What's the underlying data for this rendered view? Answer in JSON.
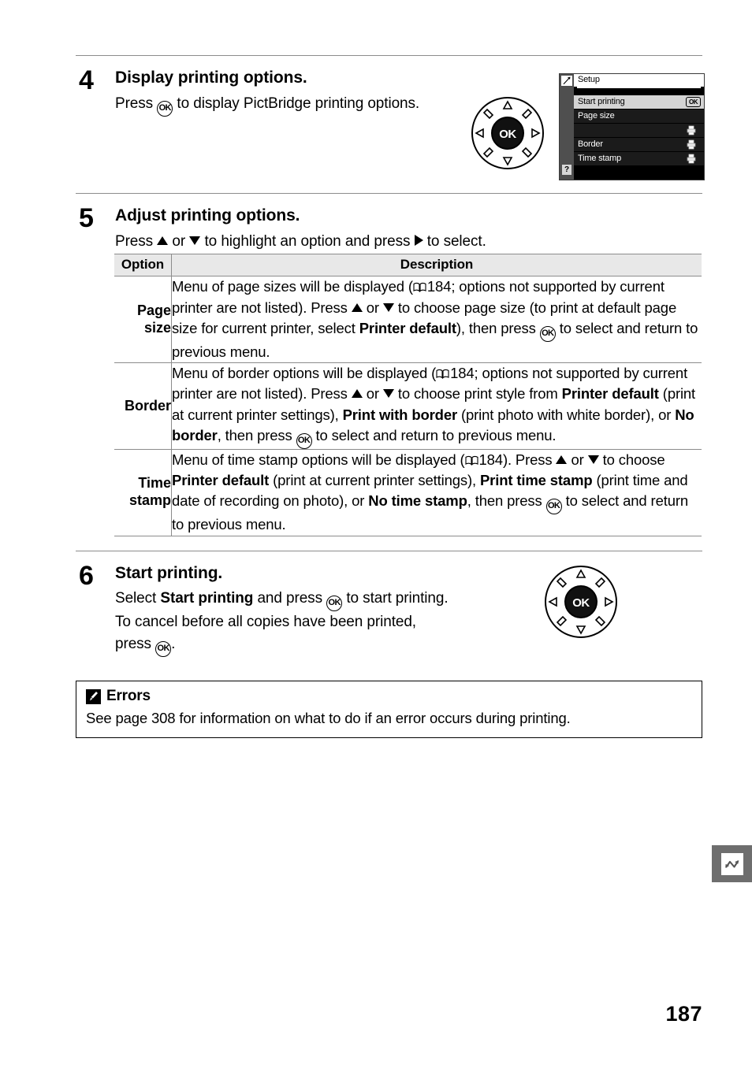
{
  "page": {
    "number": "187"
  },
  "steps": [
    {
      "number": "4",
      "title": "Display printing options.",
      "text_before_ok": "Press ",
      "text_after_ok": " to display PictBridge printing options."
    },
    {
      "number": "5",
      "title": "Adjust printing options.",
      "instruction_1": "Press ",
      "instruction_2": " or ",
      "instruction_3": " to highlight an option and press ",
      "instruction_4": " to select."
    },
    {
      "number": "6",
      "title": "Start printing.",
      "t1": "Select ",
      "t2": "Start printing",
      "t3": " and press ",
      "t4": " to start printing.  To cancel before all copies have been printed, press ",
      "t5": "."
    }
  ],
  "table": {
    "headers": {
      "option": "Option",
      "description": "Description"
    },
    "rows": [
      {
        "option_line1": "Page",
        "option_line2": "size",
        "description": {
          "s1": "Menu of page sizes will be displayed (",
          "page_ref": "184",
          "s2": "; options not supported by current printer are not listed).  Press ",
          "s3": " or ",
          "s4": " to choose page size (to print at default page size for current printer, select ",
          "bold1": "Printer default",
          "s5": "), then press ",
          "s6": " to select and return to previous menu."
        }
      },
      {
        "option_line1": "Border",
        "option_line2": "",
        "description": {
          "s1": "Menu of border options will be displayed (",
          "page_ref": "184",
          "s2": "; options not supported by current printer are not listed).  Press ",
          "s3": " or ",
          "s4": " to choose print style from ",
          "bold1": "Printer default",
          "s5": " (print at current printer settings), ",
          "bold2": "Print with border",
          "s6": " (print photo with white border), or ",
          "bold3": "No border",
          "s7": ", then press ",
          "s8": " to select and return to previous menu."
        }
      },
      {
        "option_line1": "Time",
        "option_line2": "stamp",
        "description": {
          "s1": "Menu of time stamp options will be displayed (",
          "page_ref": "184",
          "s2": ").  Press ",
          "s3": " or ",
          "s4": " to choose ",
          "bold1": "Printer default",
          "s5": " (print at current printer settings), ",
          "bold2": "Print time stamp",
          "s6": " (print time and date of recording on photo), or ",
          "bold3": "No time stamp",
          "s7": ", then press ",
          "s8": " to select and return to previous menu."
        }
      }
    ]
  },
  "note": {
    "icon": "pencil-icon",
    "title": "Errors",
    "text": "See page 308 for information on what to do if an error occurs during printing."
  },
  "lcd": {
    "title": "Setup",
    "tab_icon": "wrench-icon",
    "help_icon": "?",
    "rows": [
      {
        "label": "Start printing",
        "badge": "OK",
        "selected": true,
        "printer_icon": false
      },
      {
        "label": "Page size",
        "badge": "",
        "selected": false,
        "printer_icon": false
      },
      {
        "label": "",
        "badge": "",
        "selected": false,
        "printer_icon": true
      },
      {
        "label": "Border",
        "badge": "",
        "selected": false,
        "printer_icon": true
      },
      {
        "label": "Time stamp",
        "badge": "",
        "selected": false,
        "printer_icon": true
      }
    ]
  },
  "dial": {
    "center_label": "OK"
  },
  "thumb_tab": {
    "icon": "connection-zigzag-icon"
  },
  "colors": {
    "rule": "#8c8c8c",
    "table_header_bg": "#e8e8e8",
    "lcd_bg": "#000000",
    "lcd_selected_bg": "#d4d4d4",
    "thumb_tab_bg": "#6e6e6e"
  }
}
